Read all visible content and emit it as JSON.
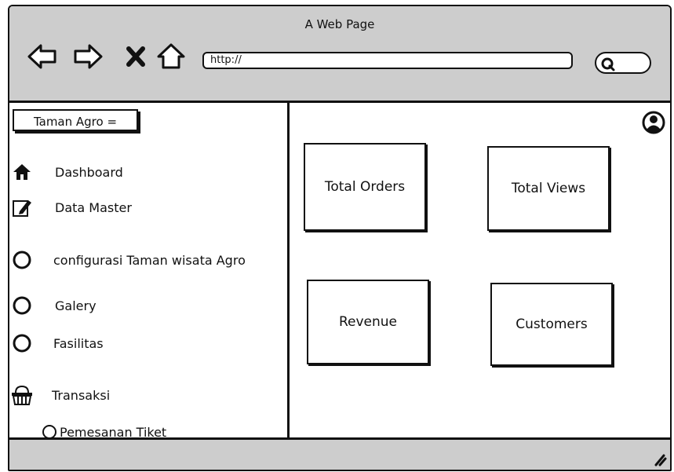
{
  "window": {
    "title": "A Web Page"
  },
  "browser": {
    "url": "http://",
    "nav_icons": [
      "back-arrow-icon",
      "forward-arrow-icon",
      "stop-icon",
      "home-icon"
    ],
    "search_icon": "search-icon"
  },
  "sidebar": {
    "brand": "Taman Agro =",
    "items": [
      {
        "label": "Dashboard",
        "icon": "home-icon"
      },
      {
        "label": "Data Master",
        "icon": "edit-icon"
      },
      {
        "label": "configurasi Taman wisata Agro",
        "icon": "circle-icon"
      },
      {
        "label": "Galery",
        "icon": "circle-icon"
      },
      {
        "label": "Fasilitas",
        "icon": "circle-icon"
      },
      {
        "label": "Transaksi",
        "icon": "basket-icon"
      }
    ],
    "subitems": [
      {
        "label": "Pemesanan Tiket",
        "icon": "circle-icon"
      }
    ]
  },
  "dashboard": {
    "cards": [
      {
        "label": "Total Orders"
      },
      {
        "label": "Total Views"
      },
      {
        "label": "Revenue"
      },
      {
        "label": "Customers"
      }
    ],
    "user_icon": "user-avatar-icon"
  }
}
